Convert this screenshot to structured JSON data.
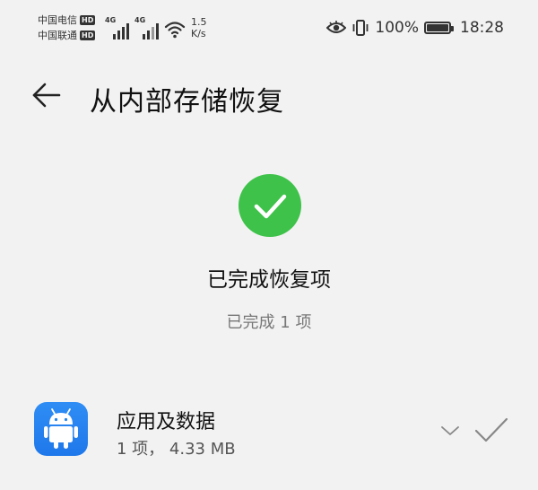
{
  "status_bar": {
    "carrier_1": "中国电信",
    "carrier_2": "中国联通",
    "hd_badge": "HD",
    "network_type": "4G",
    "speed_value": "1.5",
    "speed_unit": "K/s",
    "battery_percent": "100%",
    "time": "18:28",
    "icons": [
      "eye-comfort-icon",
      "vibrate-icon",
      "wifi-icon",
      "signal-icon",
      "battery-icon"
    ]
  },
  "header": {
    "back_icon": "back-arrow-icon",
    "title": "从内部存储恢复"
  },
  "result": {
    "icon": "success-check-icon",
    "title": "已完成恢复项",
    "subtitle": "已完成 1 项"
  },
  "list": {
    "items": [
      {
        "icon": "android-app-icon",
        "title": "应用及数据",
        "detail": "1 项， 4.33 MB"
      }
    ]
  },
  "colors": {
    "background": "#f2f2f2",
    "success_green": "#3ec24a",
    "app_icon_blue": "#2484ef",
    "text_primary": "#111111",
    "text_secondary": "#777777"
  }
}
